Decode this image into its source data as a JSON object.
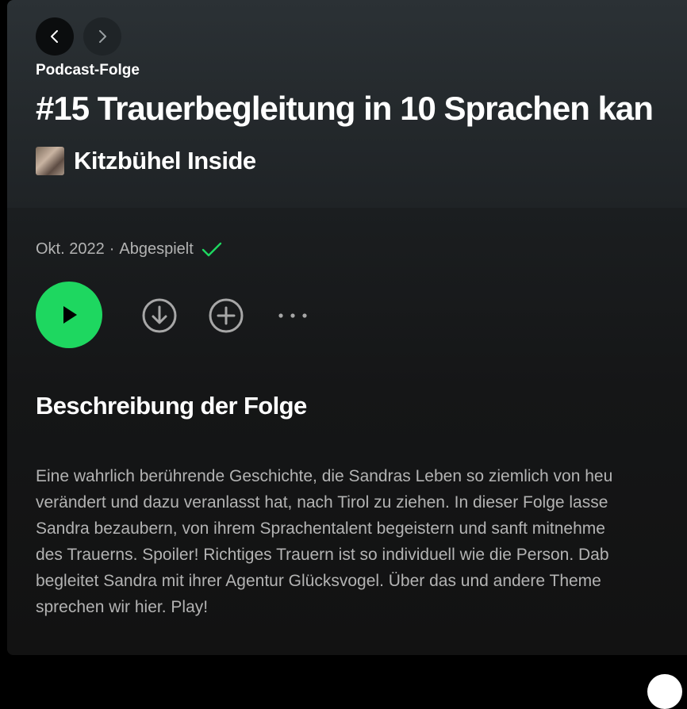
{
  "nav": {
    "back_icon": "chevron-left-icon",
    "forward_icon": "chevron-right-icon"
  },
  "header": {
    "kicker": "Podcast-Folge",
    "title": "#15 Trauerbegleitung in 10 Sprachen kan",
    "show_name": "Kitzbühel Inside"
  },
  "meta": {
    "date": "Okt. 2022",
    "separator": "·",
    "status": "Abgespielt",
    "status_color": "#1ed760"
  },
  "actions": {
    "play_icon": "play-icon",
    "download_icon": "download-icon",
    "add_icon": "add-icon",
    "more_icon": "more-icon",
    "accent": "#1ed760"
  },
  "description": {
    "heading": "Beschreibung der Folge",
    "lines": [
      "Eine wahrlich berührende Geschichte, die Sandras Leben so ziemlich von heu",
      "verändert und dazu veranlasst hat, nach Tirol zu ziehen. In dieser Folge lasse",
      "Sandra bezaubern, von ihrem Sprachentalent begeistern und sanft mitnehme",
      "des Trauerns. Spoiler! Richtiges Trauern ist so individuell wie die Person. Dab",
      "begleitet Sandra mit ihrer Agentur Glücksvogel. Über das und andere Theme",
      "sprechen wir hier. Play!"
    ]
  }
}
